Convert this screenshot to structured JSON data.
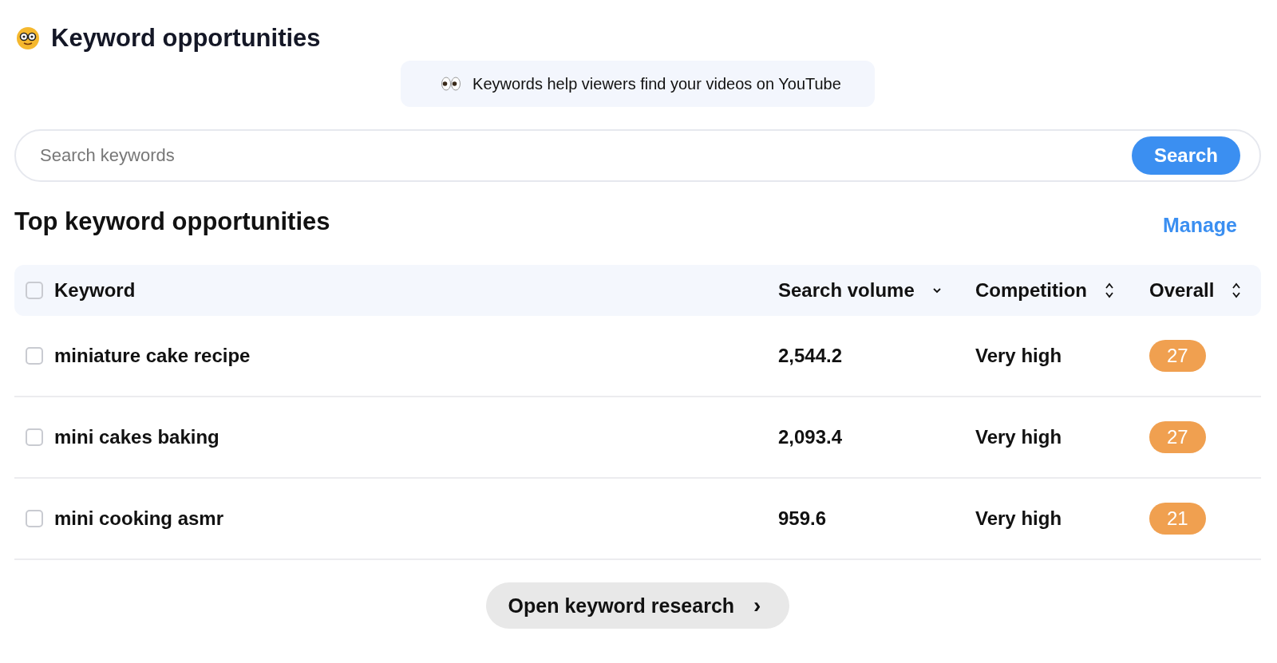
{
  "title": "Keyword opportunities",
  "tip": {
    "text": "Keywords help viewers find your videos on YouTube"
  },
  "search": {
    "placeholder": "Search keywords",
    "button": "Search"
  },
  "section": {
    "title": "Top keyword opportunities",
    "action": "Manage"
  },
  "table": {
    "select_all": {
      "checked": false
    },
    "columns": [
      {
        "label": "Keyword"
      },
      {
        "label": "Search volume",
        "kind": "sorted"
      },
      {
        "label": "Competition",
        "kind": "sortable"
      },
      {
        "label": "Overall",
        "kind": "sortable"
      }
    ],
    "rows": [
      {
        "checked": false,
        "keyword": "miniature cake recipe",
        "volume": "2,544.2",
        "competition": "Very high",
        "overall": "27"
      },
      {
        "checked": false,
        "keyword": "mini cakes baking",
        "volume": "2,093.4",
        "competition": "Very high",
        "overall": "27"
      },
      {
        "checked": false,
        "keyword": "mini cooking asmr",
        "volume": "959.6",
        "competition": "Very high",
        "overall": "21"
      }
    ]
  },
  "footer_button": {
    "label": "Open keyword research",
    "arrow": "›"
  }
}
